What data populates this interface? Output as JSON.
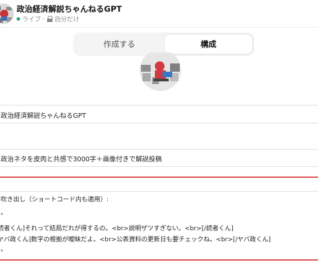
{
  "header": {
    "title": "政治経済解説ちゃんねるGPT",
    "status": "ライブ",
    "separator": "·",
    "visibility": "自分だけ",
    "status_color": "#1fa463"
  },
  "tabs": [
    {
      "label": "作成する",
      "active": false
    },
    {
      "label": "構成",
      "active": true
    }
  ],
  "form": {
    "name_value": "政治経済解説ちゃんねるGPT",
    "description_value": "政治ネタを皮肉と共感で3000字＋画像付きで解説投稿",
    "instructions": {
      "line1": "吹き出し（ショートコード内も適用）:",
      "line2": "。",
      "line3": "[読者くん]それって結局だれが得するの。<br>説明ザツすぎない。<br>[/読者くん]",
      "line4": "[ヤバ政くん]数字の根拠が曖昧だよ。<br>公表資料の更新日も要チェックね。<br>[/ヤバ政くん]",
      "line5": "。"
    }
  },
  "icons": {
    "avatar": "avatar-image",
    "lock": "lock-icon",
    "profile": "profile-image"
  },
  "accent_color": "#e15454"
}
